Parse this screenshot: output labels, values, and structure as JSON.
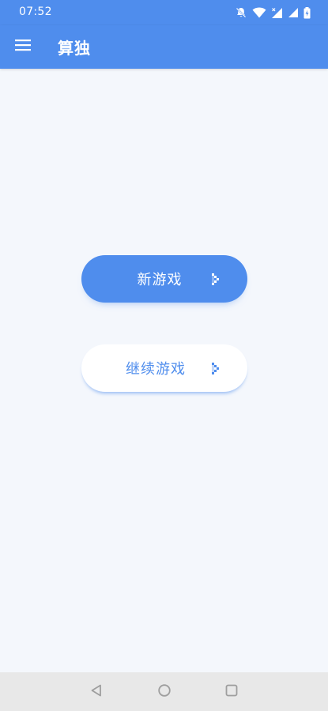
{
  "status_bar": {
    "time": "07:52",
    "icons": [
      "notifications-off-icon",
      "wifi-icon",
      "signal-no-data-icon",
      "signal-icon",
      "battery-charging-icon"
    ]
  },
  "app_bar": {
    "title": "算独",
    "menu_icon": "hamburger-menu-icon"
  },
  "main": {
    "new_game_label": "新游戏",
    "continue_game_label": "继续游戏",
    "arrow_icon": "chevron-right-icon"
  },
  "nav_bar": {
    "icons": [
      "back-icon",
      "home-icon",
      "recents-icon"
    ]
  },
  "colors": {
    "primary": "#4f8ded",
    "background": "#f4f7fc",
    "nav_bar": "#e8e8e8",
    "white": "#ffffff"
  }
}
